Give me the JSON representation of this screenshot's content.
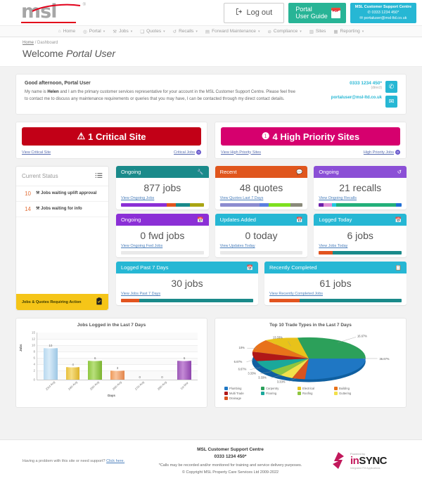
{
  "header": {
    "logo_text": "msl",
    "logout_label": "Log out",
    "guide_line1": "Portal",
    "guide_line2": "User Guide",
    "support": {
      "title": "MSL Customer Support Centre",
      "phone": "0333 1234 450*",
      "email": "portaluser@msl-ltd.co.uk"
    }
  },
  "nav": {
    "items": [
      {
        "label": "Home",
        "icon": "home-icon",
        "caret": false
      },
      {
        "label": "Portal",
        "icon": "portal-icon",
        "caret": true
      },
      {
        "label": "Jobs",
        "icon": "wrench-icon",
        "caret": true
      },
      {
        "label": "Quotes",
        "icon": "quote-icon",
        "caret": true
      },
      {
        "label": "Recalls",
        "icon": "recall-icon",
        "caret": true
      },
      {
        "label": "Forward Maintenance",
        "icon": "calendar-icon",
        "caret": true
      },
      {
        "label": "Compliance",
        "icon": "compliance-icon",
        "caret": true
      },
      {
        "label": "Sites",
        "icon": "sites-icon",
        "caret": false
      },
      {
        "label": "Reporting",
        "icon": "chart-icon",
        "caret": true
      }
    ]
  },
  "breadcrumb": {
    "home": "Home",
    "separator": "/",
    "current": "Dashboard"
  },
  "page_title": {
    "prefix": "Welcome ",
    "user": "Portal User"
  },
  "greeting": {
    "title": "Good afternoon, Portal User",
    "body_1": "My name is ",
    "rep_name": "Helen",
    "body_2": " and I am the primary customer services representative for your account in the MSL Customer Support Centre. Please feel free to contact me to discuss any maintenance requirements or queries that you may have, I can be contacted through my direct contact details.",
    "phone": "0333 1234 450*",
    "direct_label": "(direct)",
    "email": "portaluser@msl-ltd.co.uk",
    "phone_icon": "phone-icon",
    "mail_icon": "mail-icon"
  },
  "priority": {
    "critical": {
      "banner": "1 Critical Site",
      "icon": "warning-triangle-icon",
      "left_link": "View Critical Site",
      "right_link": "Critical Jobs",
      "right_count": "0",
      "color": "#c20017"
    },
    "high": {
      "banner": "4 High Priority Sites",
      "icon": "exclamation-circle-icon",
      "left_link": "View High Priority Sites",
      "right_link": "High Priority Jobs",
      "right_count": "0",
      "color": "#d6006e"
    }
  },
  "current_status": {
    "title": "Current Status",
    "icon": "checklist-icon",
    "rows": [
      {
        "count": "10",
        "label": "Jobs waiting uplift approval",
        "icon": "wrench-icon"
      },
      {
        "count": "14",
        "label": "Jobs waiting for info",
        "icon": "wrench-icon"
      }
    ],
    "footer_label": "Jobs & Quotes Requiring Action",
    "footer_icon": "clipboard-check-icon",
    "footer_color": "#f5c518"
  },
  "stat_cards": [
    {
      "heading": "Ongoing",
      "icon": "wrench-icon",
      "color": "#1a8a8a",
      "value": "877 jobs",
      "link": "View Ongoing Jobs",
      "progress": [
        {
          "color": "#8b2fd6",
          "pct": 55
        },
        {
          "color": "#e2541f",
          "pct": 11
        },
        {
          "color": "#1a8a8a",
          "pct": 17
        },
        {
          "color": "#a9a513",
          "pct": 17
        }
      ]
    },
    {
      "heading": "Recent",
      "icon": "quotes-icon",
      "color": "#e0561d",
      "value": "48 quotes",
      "link": "View Quotes Last 7 Days",
      "progress": [
        {
          "color": "#8c8cd0",
          "pct": 48
        },
        {
          "color": "#5b7fe0",
          "pct": 11
        },
        {
          "color": "#7ee01f",
          "pct": 26
        },
        {
          "color": "#8a8a7a",
          "pct": 15
        }
      ]
    },
    {
      "heading": "Ongoing",
      "icon": "recall-icon",
      "color": "#8b4fd6",
      "value": "21 recalls",
      "link": "View Ongoing Recalls",
      "progress": [
        {
          "color": "#6b1fa8",
          "pct": 6
        },
        {
          "color": "#e08fd6",
          "pct": 10
        },
        {
          "color": "#23c8e0",
          "pct": 5
        },
        {
          "color": "#23b07a",
          "pct": 72
        },
        {
          "color": "#1f6fd6",
          "pct": 7
        }
      ]
    },
    {
      "heading": "Ongoing",
      "icon": "calendar-icon",
      "color": "#8b2fd6",
      "value": "0 fwd jobs",
      "link": "View Ongoing Fwd Jobs",
      "progress": []
    },
    {
      "heading": "Updates Added",
      "icon": "calendar-icon",
      "color": "#26b7d4",
      "value": "0 today",
      "link": "View Updates Today",
      "progress": []
    },
    {
      "heading": "Logged Today",
      "icon": "calendar-icon",
      "color": "#26b7d4",
      "value": "6 jobs",
      "link": "View Jobs Today",
      "progress": [
        {
          "color": "#e2541f",
          "pct": 17
        },
        {
          "color": "#1a8a8a",
          "pct": 83
        }
      ]
    },
    {
      "heading": "Logged Past 7 Days",
      "icon": "calendar-icon",
      "color": "#26b7d4",
      "value": "30 jobs",
      "link": "View Jobs Past 7 Days",
      "progress": [
        {
          "color": "#e2541f",
          "pct": 14
        },
        {
          "color": "#1a8a8a",
          "pct": 86
        }
      ]
    },
    {
      "heading": "Recently Completed",
      "icon": "clipboard-check-icon",
      "color": "#26b7d4",
      "value": "61 jobs",
      "link": "View Recently Completed Jobs",
      "progress": [
        {
          "color": "#e2541f",
          "pct": 23
        },
        {
          "color": "#1a8a8a",
          "pct": 77
        }
      ]
    }
  ],
  "chart_data": [
    {
      "type": "bar",
      "title": "Jobs Logged in the Last 7 Days",
      "xlabel": "Days",
      "ylabel": "Jobs",
      "ylim": [
        0,
        15
      ],
      "yticks": [
        "0",
        "2",
        "4",
        "6",
        "8",
        "10",
        "12",
        "15"
      ],
      "categories": [
        "23rd Aug",
        "24th Aug",
        "25th Aug",
        "26th Aug",
        "27th Aug",
        "28th Aug",
        "1st Mar"
      ],
      "values": [
        10,
        4,
        6,
        3,
        0,
        0,
        6
      ],
      "colors": [
        "#a8cde8",
        "#e8c03a",
        "#8ec63f",
        "#ef9a5a",
        "#cccccc",
        "#cccccc",
        "#9b59b6"
      ],
      "grid": true
    },
    {
      "type": "pie",
      "title": "Top 10 Trade Types in the Last 7 Days",
      "labels": [
        "Plumbing",
        "Carpentry",
        "Electrical",
        "Building",
        "Multi Trade",
        "Flooring",
        "Roofing",
        "Guttering",
        "Drainage"
      ],
      "values": [
        36.67,
        16.67,
        13.33,
        10,
        6.67,
        6.67,
        3.33,
        3.33,
        3.33
      ],
      "value_labels": [
        "36.67%",
        "16.67%",
        "13.33%",
        "10%",
        "6.67%",
        "6.67%",
        "3.33%",
        "3.33%",
        "3.33%"
      ],
      "colors": [
        "#1f77c4",
        "#2ca05a",
        "#e8c21a",
        "#e8721a",
        "#b01818",
        "#1aa89b",
        "#8ec63f",
        "#f2e04a",
        "#d9531e"
      ],
      "legend": "bottom"
    }
  ],
  "footer": {
    "support_prompt": "Having a problem with this site or need support? ",
    "support_link": "Click here.",
    "centre_title": "MSL Customer Support Centre",
    "centre_phone": "0333 1234 450*",
    "calls_note": "*Calls may be recorded and/or monitored for training and service delivery purposes.",
    "copyright": "© Copyright MSL Property Care Services Ltd 2009-2022",
    "brand_powered": "Powered by",
    "brand_name_1": "in",
    "brand_name_2": "SYNC",
    "brand_sub": "Integrated FM Applications"
  }
}
